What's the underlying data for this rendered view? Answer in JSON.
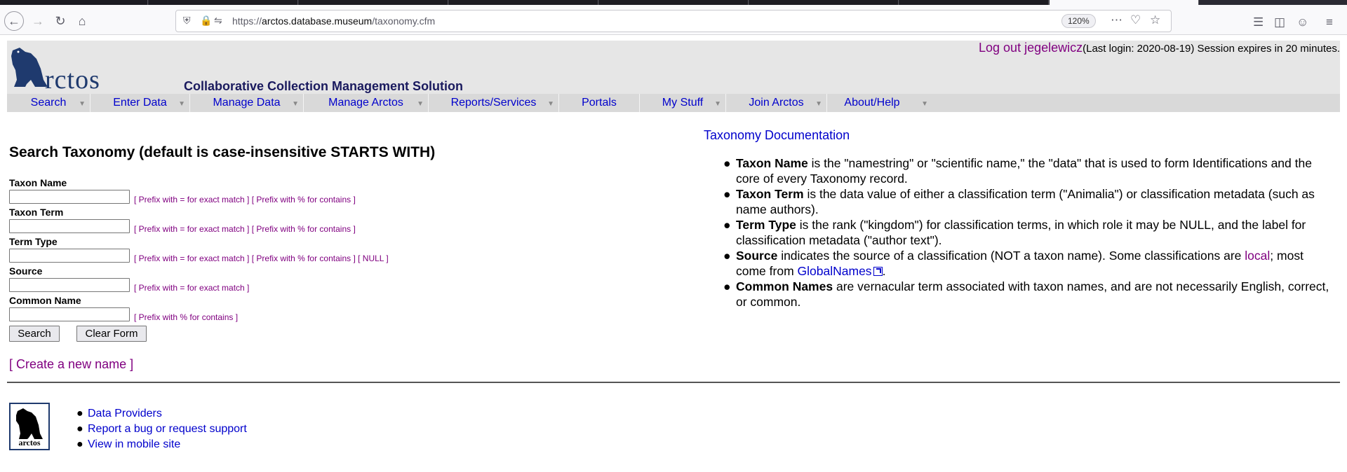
{
  "browser": {
    "url_prefix": "https://",
    "url_host": "arctos.database.museum",
    "url_path": "/taxonomy.cfm",
    "zoom": "120%"
  },
  "header": {
    "logo_text": "rctos",
    "tagline": "Collaborative Collection Management Solution",
    "logout_label": "Log out jegelewicz",
    "session_info": "(Last login: 2020-08-19)  Session expires in 20 minutes."
  },
  "menu": [
    {
      "label": "Search"
    },
    {
      "label": "Enter Data"
    },
    {
      "label": "Manage Data"
    },
    {
      "label": "Manage Arctos"
    },
    {
      "label": "Reports/Services"
    },
    {
      "label": "Portals"
    },
    {
      "label": "My Stuff"
    },
    {
      "label": "Join Arctos"
    },
    {
      "label": "About/Help"
    }
  ],
  "search": {
    "title": "Search Taxonomy (default is case-insensitive STARTS WITH)",
    "fields": [
      {
        "label": "Taxon Name",
        "value": "",
        "hint": "[ Prefix with = for exact match ] [ Prefix with % for contains ]"
      },
      {
        "label": "Taxon Term",
        "value": "",
        "hint": "[ Prefix with = for exact match ] [ Prefix with % for contains ]"
      },
      {
        "label": "Term Type",
        "value": "",
        "hint": "[ Prefix with = for exact match ] [ Prefix with % for contains ] [ NULL ]"
      },
      {
        "label": "Source",
        "value": "",
        "hint": "[ Prefix with = for exact match ]"
      },
      {
        "label": "Common Name",
        "value": "",
        "hint": "[ Prefix with % for contains ]"
      }
    ],
    "search_button": "Search",
    "clear_button": "Clear Form",
    "create_link": "[ Create a new name ]"
  },
  "docs": {
    "link": "Taxonomy Documentation",
    "items": [
      {
        "term": "Taxon Name",
        "text": " is the \"namestring\" or \"scientific name,\" the \"data\" that is used to form Identifications and the core of every Taxonomy record."
      },
      {
        "term": "Taxon Term",
        "text": " is the data value of either a classification term (\"Animalia\") or classification metadata (such as name authors)."
      },
      {
        "term": "Term Type",
        "text": " is the rank (\"kingdom\") for classification terms, in which role it may be NULL, and the label for classification metadata (\"author text\")."
      },
      {
        "term": "Source",
        "text_a": " indicates the source of a classification (NOT a taxon name). Some classifications are ",
        "link_local": "local",
        "text_b": "; most come from ",
        "link_gn": "GlobalNames",
        "text_c": "."
      },
      {
        "term": "Common Names",
        "text": " are vernacular term associated with taxon names, and are not necessarily English, correct, or common."
      }
    ]
  },
  "footer": {
    "logo_text": "arctos",
    "links": [
      "Data Providers",
      "Report a bug or request support",
      "View in mobile site"
    ]
  }
}
